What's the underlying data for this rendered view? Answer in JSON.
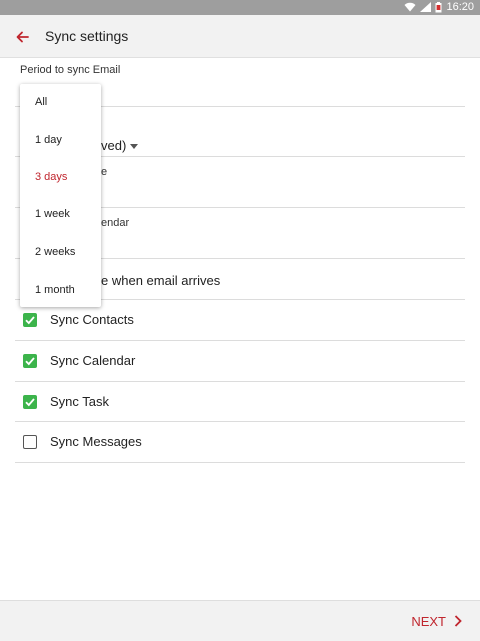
{
  "status_bar": {
    "time": "16:20"
  },
  "app_bar": {
    "title": "Sync settings"
  },
  "section_label": "Period to sync Email",
  "hidden_rows": {
    "row2_fragment": "ved)",
    "row3_fragment": "e",
    "row4_fragment": "endar",
    "row5_fragment": "e when email arrives"
  },
  "checkboxes": [
    {
      "label": "Sync Contacts",
      "checked": true
    },
    {
      "label": "Sync Calendar",
      "checked": true
    },
    {
      "label": "Sync Task",
      "checked": true
    },
    {
      "label": "Sync Messages",
      "checked": false
    }
  ],
  "dropdown": {
    "options": [
      "All",
      "1 day",
      "3 days",
      "1 week",
      "2 weeks",
      "1 month"
    ],
    "selected": "3 days"
  },
  "bottom_bar": {
    "next_label": "NEXT"
  },
  "colors": {
    "accent": "#c0262e",
    "check_green": "#3cb44b"
  }
}
